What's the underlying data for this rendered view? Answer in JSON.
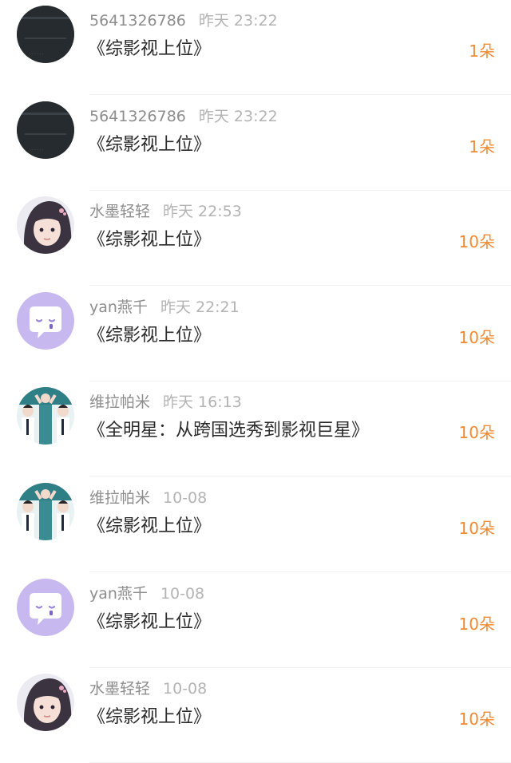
{
  "rows": [
    {
      "avatar": "dark-photo",
      "name": "5641326786",
      "time": "昨天 23:22",
      "title": "《综影视上位》",
      "gift": "1朵"
    },
    {
      "avatar": "dark-photo",
      "name": "5641326786",
      "time": "昨天 23:22",
      "title": "《综影视上位》",
      "gift": "1朵"
    },
    {
      "avatar": "girl-portrait",
      "name": "水墨轻轻",
      "time": "昨天 22:53",
      "title": "《综影视上位》",
      "gift": "10朵"
    },
    {
      "avatar": "chat-bubble-icon",
      "name": "yan燕千",
      "time": "昨天 22:21",
      "title": "《综影视上位》",
      "gift": "10朵"
    },
    {
      "avatar": "group-photo",
      "name": "维拉帕米",
      "time": "昨天 16:13",
      "title": "《全明星：从跨国选秀到影视巨星》",
      "gift": "10朵"
    },
    {
      "avatar": "group-photo",
      "name": "维拉帕米",
      "time": "10-08",
      "title": "《综影视上位》",
      "gift": "10朵"
    },
    {
      "avatar": "chat-bubble-icon",
      "name": "yan燕千",
      "time": "10-08",
      "title": "《综影视上位》",
      "gift": "10朵"
    },
    {
      "avatar": "girl-portrait",
      "name": "水墨轻轻",
      "time": "10-08",
      "title": "《综影视上位》",
      "gift": "10朵"
    }
  ],
  "colors": {
    "gift": "#f08a34",
    "name": "#8d8d8d",
    "time": "#b3b3b3",
    "title": "#2a2a2a",
    "chat_avatar_bg": "#c8b8f0"
  }
}
